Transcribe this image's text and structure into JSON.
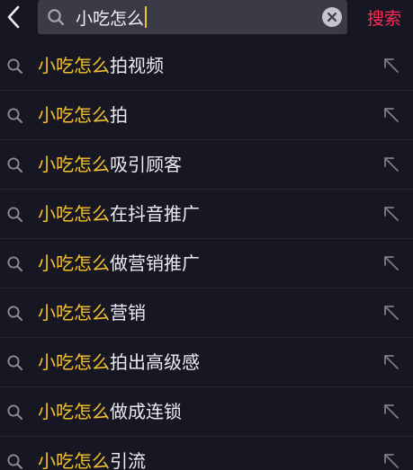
{
  "header": {
    "query": "小吃怎么",
    "search_label": "搜索",
    "icons": {
      "back": "chevron-left-icon",
      "search": "search-icon",
      "clear": "clear-icon"
    }
  },
  "suggestions": [
    {
      "highlight": "小吃怎么",
      "rest": "拍视频"
    },
    {
      "highlight": "小吃怎么",
      "rest": "拍"
    },
    {
      "highlight": "小吃怎么",
      "rest": "吸引顾客"
    },
    {
      "highlight": "小吃怎么",
      "rest": "在抖音推广"
    },
    {
      "highlight": "小吃怎么",
      "rest": "做营销推广"
    },
    {
      "highlight": "小吃怎么",
      "rest": "营销"
    },
    {
      "highlight": "小吃怎么",
      "rest": "拍出高级感"
    },
    {
      "highlight": "小吃怎么",
      "rest": "做成连锁"
    },
    {
      "highlight": "小吃怎么",
      "rest": "引流"
    }
  ],
  "colors": {
    "background": "#161722",
    "search_box": "#3a3b46",
    "highlight": "#f6c22b",
    "search_button": "#fe2c55"
  }
}
